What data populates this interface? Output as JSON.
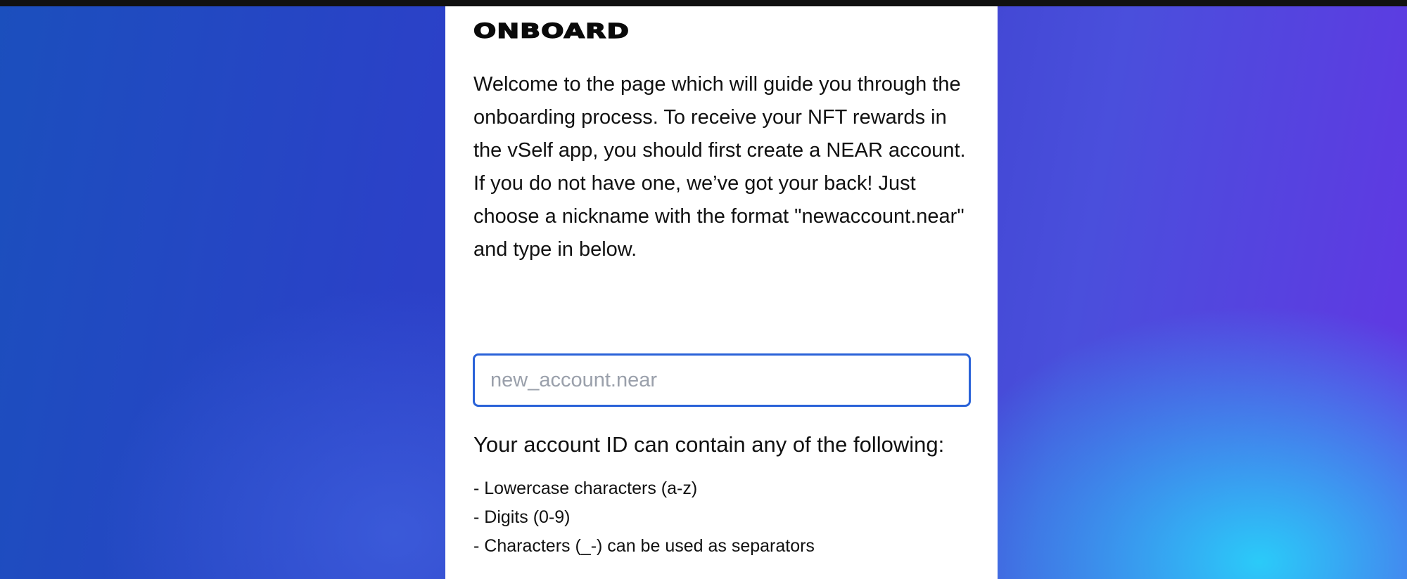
{
  "header": {
    "logo_text": "ONBOARD"
  },
  "intro": {
    "text": "Welcome to the page which will guide you through the onboarding process. To receive your NFT rewards in the vSelf app, you should first create a NEAR account. If you do not have one, we’ve got your back! Just choose a nickname with the format \"newaccount.near\" and type in below."
  },
  "account_field": {
    "value": "",
    "placeholder": "new_account.near"
  },
  "rules": {
    "heading": "Your account ID can contain any of the following:",
    "items": [
      "- Lowercase characters (a-z)",
      "- Digits (0-9)",
      "- Characters (_-) can be used as separators"
    ]
  },
  "colors": {
    "input_border": "#2a62d8",
    "top_bar": "#111111",
    "card_background": "#ffffff"
  }
}
